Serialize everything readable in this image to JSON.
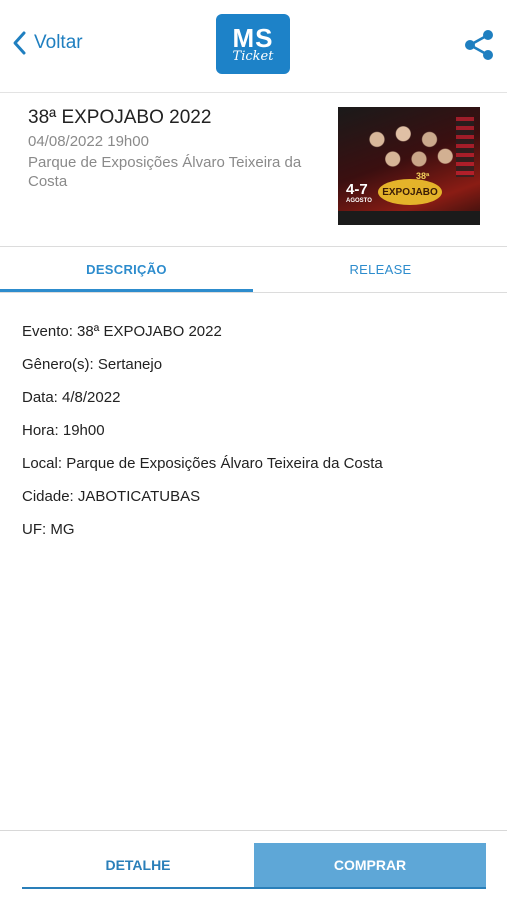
{
  "header": {
    "back_label": "Voltar",
    "logo_line1": "MS",
    "logo_line2": "Ticket"
  },
  "event": {
    "title": "38ª EXPOJABO 2022",
    "datetime": "04/08/2022 19h00",
    "place": "Parque de Exposições Álvaro Teixeira da Costa",
    "poster": {
      "edition": "38ª",
      "days": "4-7",
      "month": "AGOSTO",
      "name": "EXPOJABO"
    }
  },
  "tabs": [
    {
      "label": "DESCRIÇÃO",
      "active": true
    },
    {
      "label": "RELEASE",
      "active": false
    }
  ],
  "details": [
    "Evento: 38ª EXPOJABO 2022",
    "Gênero(s): Sertanejo",
    "Data: 4/8/2022",
    "Hora: 19h00",
    "Local: Parque de Exposições Álvaro Teixeira da Costa",
    "Cidade: JABOTICATUBAS",
    "UF: MG"
  ],
  "footer": {
    "detalhe_label": "DETALHE",
    "comprar_label": "COMPRAR"
  },
  "colors": {
    "accent": "#2d8ccd",
    "buy_button": "#5ea7d7",
    "logo_bg": "#1d82c8"
  }
}
